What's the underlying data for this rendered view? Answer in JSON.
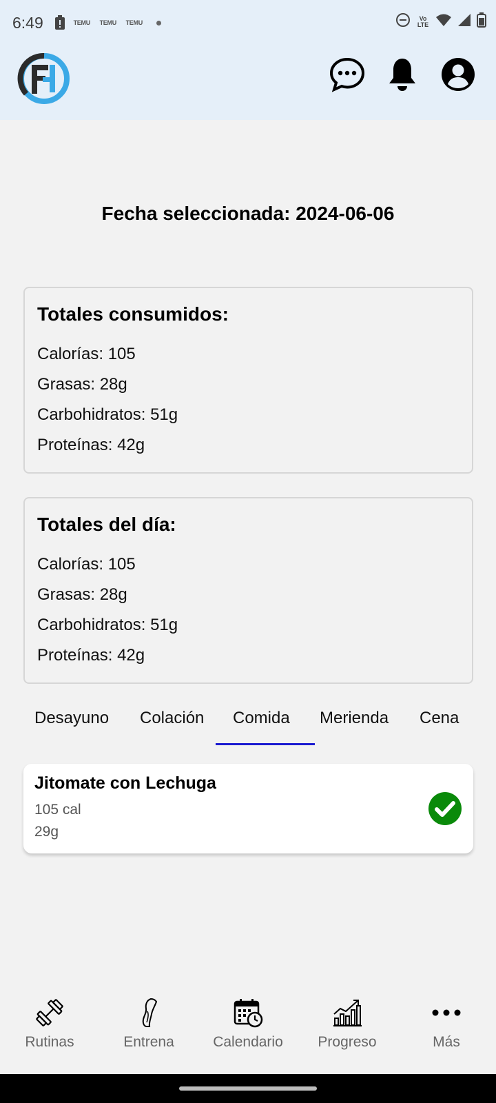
{
  "status": {
    "time": "6:49",
    "notif_labels": [
      "TEMU",
      "TEMU",
      "TEMU"
    ],
    "volte_label": "Vo LTE"
  },
  "header": {
    "logo_icon": "app-logo-icon",
    "icons": [
      "chat-icon",
      "bell-icon",
      "account-icon"
    ]
  },
  "main": {
    "date_title": "Fecha seleccionada: 2024-06-06",
    "consumed": {
      "title": "Totales consumidos:",
      "lines": [
        "Calorías: 105",
        "Grasas: 28g",
        "Carbohidratos: 51g",
        "Proteínas: 42g"
      ]
    },
    "day": {
      "title": "Totales del día:",
      "lines": [
        "Calorías: 105",
        "Grasas: 28g",
        "Carbohidratos: 51g",
        "Proteínas: 42g"
      ]
    }
  },
  "tabs": {
    "items": [
      "Desayuno",
      "Colación",
      "Comida",
      "Merienda",
      "Cena"
    ],
    "selected": "Comida",
    "indicator_color": "#1a1ad0"
  },
  "meals": [
    {
      "name": "Jitomate con Lechuga",
      "calories": "105 cal",
      "weight": "29g",
      "status_color": "#0a8a0a"
    }
  ],
  "bottom_nav": {
    "items": [
      {
        "label": "Rutinas",
        "icon": "dumbbell-icon"
      },
      {
        "label": "Entrena",
        "icon": "leg-icon"
      },
      {
        "label": "Calendario",
        "icon": "calendar-clock-icon"
      },
      {
        "label": "Progreso",
        "icon": "chart-growth-icon"
      },
      {
        "label": "Más",
        "icon": "more-dots-icon"
      }
    ]
  },
  "colors": {
    "header_bg": "#e5eff9",
    "page_bg": "#f2f2f2",
    "logo_blue": "#3ba9e6",
    "logo_dark": "#2b2b2b"
  }
}
